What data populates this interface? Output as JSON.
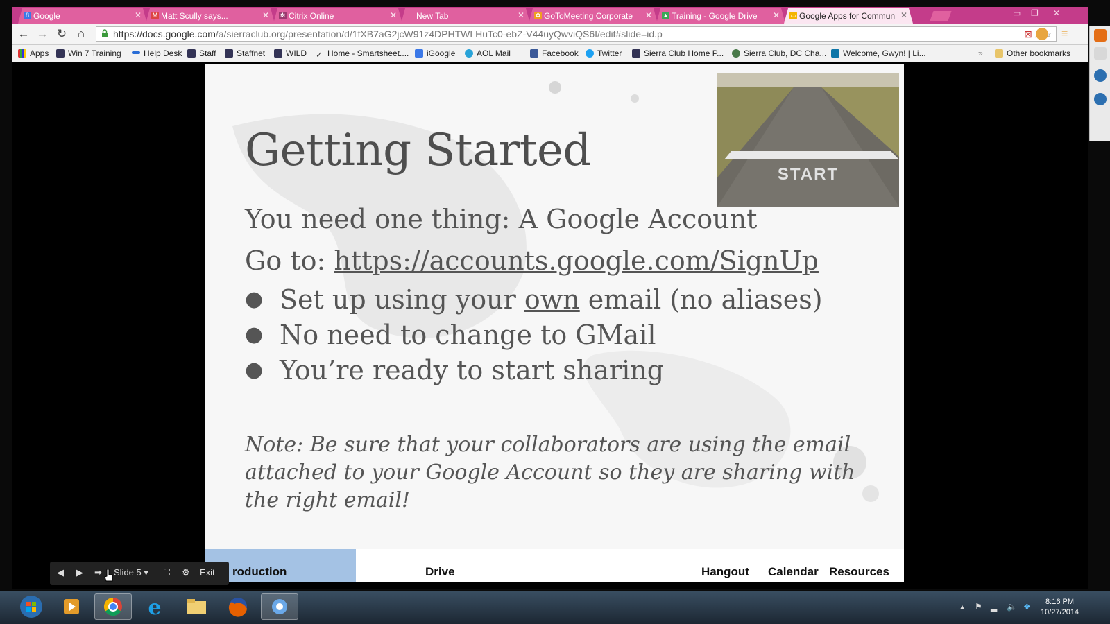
{
  "browser": {
    "tabs": [
      {
        "label": "Google",
        "icon": "google-icon",
        "active": false
      },
      {
        "label": "Matt Scully says...",
        "icon": "gmail-icon",
        "active": false
      },
      {
        "label": "Citrix Online",
        "icon": "citrix-icon",
        "active": false
      },
      {
        "label": "New Tab",
        "icon": "",
        "active": false
      },
      {
        "label": "GoToMeeting Corporate",
        "icon": "gotomeeting-icon",
        "active": false
      },
      {
        "label": "Training - Google Drive",
        "icon": "drive-icon",
        "active": false
      },
      {
        "label": "Google Apps for Commun",
        "icon": "slides-icon",
        "active": true
      }
    ],
    "url_host": "https://docs.google.com",
    "url_rest": "/a/sierraclub.org/presentation/d/1fXB7aG2jcW91z4DPHTWLHuTc0-ebZ-V44uyQwviQS6I/edit#slide=id.p",
    "bookmarks": [
      {
        "label": "Apps"
      },
      {
        "label": "Win 7 Training"
      },
      {
        "label": "Help Desk"
      },
      {
        "label": "Staff"
      },
      {
        "label": "Staffnet"
      },
      {
        "label": "WILD"
      },
      {
        "label": "Home - Smartsheet...."
      },
      {
        "label": "iGoogle"
      },
      {
        "label": "AOL Mail"
      },
      {
        "label": "Facebook"
      },
      {
        "label": "Twitter"
      },
      {
        "label": "Sierra Club Home P..."
      },
      {
        "label": "Sierra Club, DC Cha..."
      },
      {
        "label": "Welcome, Gwyn! | Li..."
      }
    ],
    "other_bookmarks": "Other bookmarks",
    "overflow_glyph": "»"
  },
  "slide": {
    "title": "Getting Started",
    "photo_text": "START",
    "line1": "You need one thing: A Google Account",
    "line2_prefix": "Go to: ",
    "line2_link": "https://accounts.google.com/SignUp",
    "bullets": {
      "b1_pre": "Set up using your ",
      "b1_u": "own",
      "b1_post": " email (no aliases)",
      "b2": "No need to change to GMail",
      "b3": "You’re ready to start sharing"
    },
    "bullet_glyph": "●",
    "note": "Note: Be sure that your collaborators are using the email attached to your Google Account so they are sharing with the right email!",
    "nav": {
      "introduction": "roduction",
      "drive": "Drive",
      "hangout": "Hangout",
      "calendar": "Calendar",
      "resources": "Resources"
    }
  },
  "presenter": {
    "slide_label": "Slide 5",
    "exit_label": "Exit"
  },
  "taskbar": {
    "time": "8:16 PM",
    "date": "10/27/2014"
  },
  "colors": {
    "tab_strip": "#c43c8a",
    "nav_active": "#a4c2e4",
    "slide_text": "#555555"
  }
}
